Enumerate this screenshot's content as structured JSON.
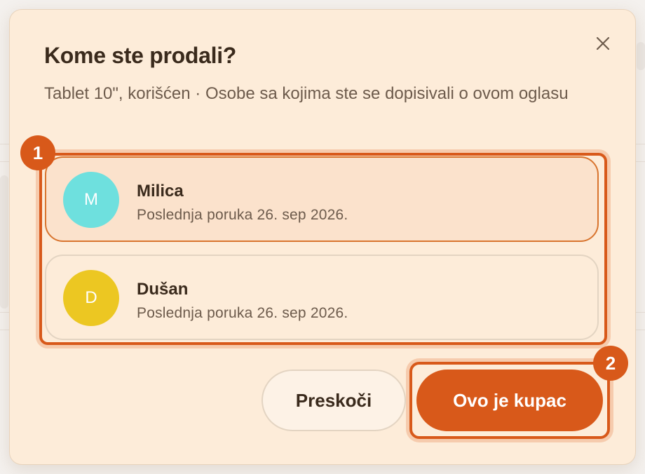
{
  "modal": {
    "title": "Kome ste prodali?",
    "subtitle": "Tablet 10\", korišćen · Osobe sa kojima ste se dopisivali o ovom oglasu",
    "close_icon": "close-icon"
  },
  "buyers": [
    {
      "initial": "M",
      "name": "Milica",
      "meta": "Poslednja poruka 26. sep 2026.",
      "avatar_color": "#6ee0de",
      "selected": true
    },
    {
      "initial": "D",
      "name": "Dušan",
      "meta": "Poslednja poruka 26. sep 2026.",
      "avatar_color": "#ecc722",
      "selected": false
    }
  ],
  "actions": {
    "skip_label": "Preskoči",
    "confirm_label": "Ovo je kupac"
  },
  "markers": {
    "list_marker": "1",
    "confirm_marker": "2"
  },
  "colors": {
    "accent": "#d8591a",
    "modal_bg": "#fdecd9",
    "selected_row_bg": "#fbe2cc"
  }
}
